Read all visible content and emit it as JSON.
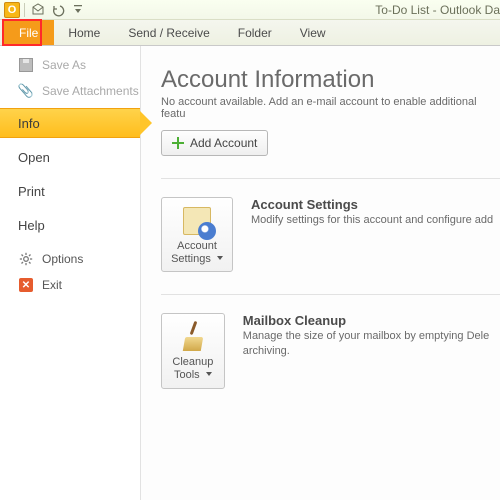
{
  "app": {
    "title": "To-Do List - Outlook Da",
    "product_initial": "O"
  },
  "ribbon": {
    "tabs": {
      "file": "File",
      "home": "Home",
      "send_receive": "Send / Receive",
      "folder": "Folder",
      "view": "View"
    }
  },
  "sidebar": {
    "save_as": "Save As",
    "save_attachments": "Save Attachments",
    "info": "Info",
    "open": "Open",
    "print": "Print",
    "help": "Help",
    "options": "Options",
    "exit": "Exit"
  },
  "content": {
    "heading": "Account Information",
    "sub": "No account available. Add an e-mail account to enable additional featu",
    "add_account": "Add Account",
    "sections": {
      "account_settings": {
        "button_line1": "Account",
        "button_line2": "Settings",
        "title": "Account Settings",
        "desc": "Modify settings for this account and configure add"
      },
      "mailbox_cleanup": {
        "button_line1": "Cleanup",
        "button_line2": "Tools",
        "title": "Mailbox Cleanup",
        "desc": "Manage the size of your mailbox by emptying Dele archiving."
      }
    }
  }
}
